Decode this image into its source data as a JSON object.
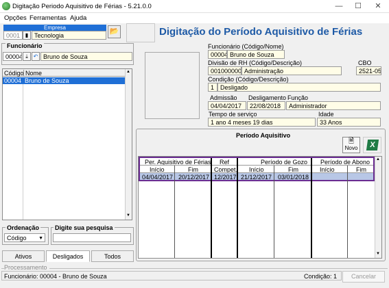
{
  "window": {
    "title": "Digitação Periodo Aquisitivo de Férias - 5.21.0.0"
  },
  "menu": [
    "Opções",
    "Ferramentas",
    "Ajuda"
  ],
  "empresa": {
    "header": "Empresa",
    "code": "0001",
    "name": "Tecnologia"
  },
  "page_title": "Digitação do Período Aquisitivo de Férias",
  "funcionario_left": {
    "group_label": "Funcionário",
    "code": "00004",
    "name": "Bruno de Souza"
  },
  "employee_list": {
    "columns": [
      "Código",
      "Nome"
    ],
    "rows": [
      {
        "code": "00004",
        "name": "Bruno de Souza"
      }
    ]
  },
  "ordenacao": {
    "label": "Ordenação",
    "value": "Código"
  },
  "pesquisa": {
    "label": "Digite sua pesquisa",
    "value": ""
  },
  "tabs": [
    "Ativos",
    "Desligados",
    "Todos"
  ],
  "details": {
    "funcionario_label": "Funcionário (Código/Nome)",
    "funcionario_code": "00004",
    "funcionario_name": "Bruno de Souza",
    "divisao_label": "Divisão de RH (Código/Descrição)",
    "divisao_code": "001000000",
    "divisao_desc": "Administração",
    "cbo_label": "CBO",
    "cbo_value": "2521-05",
    "condicao_label": "Condição (Código/Descrição)",
    "condicao_code": "1",
    "condicao_desc": "Desligado",
    "admissao_label": "Admissão",
    "admissao_value": "04/04/2017",
    "desligamento_label": "Desligamento",
    "desligamento_value": "22/08/2018",
    "funcao_label": "Função",
    "funcao_value": "Administrador",
    "tempo_label": "Tempo de serviço",
    "tempo_value": "1 ano 4 meses 19 dias",
    "idade_label": "Idade",
    "idade_value": "33 Anos"
  },
  "periodo": {
    "title": "Período Aquisitivo",
    "novo_label": "Novo",
    "group_headers": [
      "Per. Aquisitivo de Férias",
      "Ref",
      "Período de Gozo",
      "Período de Abono"
    ],
    "sub_headers": [
      "Início",
      "Fim",
      "Compet.",
      "Início",
      "Fim",
      "Início",
      "Fim"
    ],
    "rows": [
      [
        "04/04/2017",
        "20/12/2017",
        "12/2017",
        "21/12/2017",
        "03/01/2018",
        "",
        ""
      ]
    ]
  },
  "processamento": {
    "label": "Processamento"
  },
  "status": {
    "funcionario_text": "Funcionário: 00004 - Bruno de Souza",
    "condicao_text": "Condição: 1",
    "cancelar_label": "Cancelar"
  },
  "colors": {
    "title_blue": "#1e5aa6",
    "header_blue": "#1f6fd6",
    "selection": "#1f6fd6",
    "grid_border": "#6a2c91"
  }
}
